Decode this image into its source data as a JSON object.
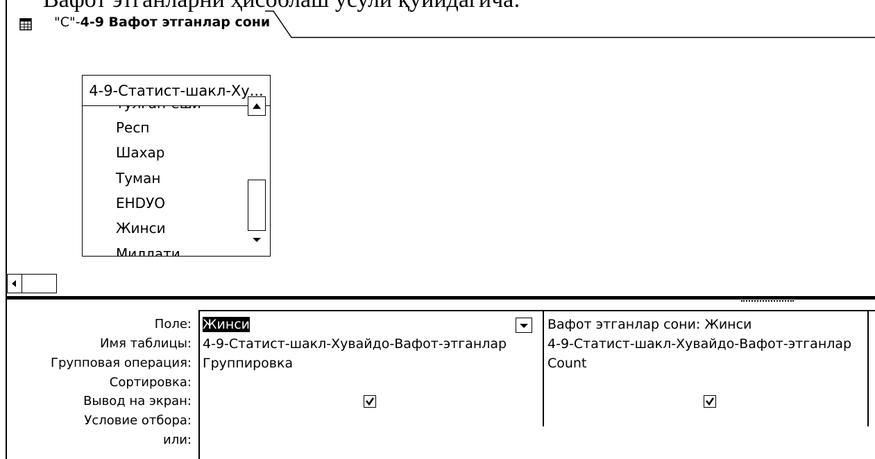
{
  "document": {
    "heading": "Вафот этганларни ҳисоблаш усули қуйидагича:"
  },
  "tab": {
    "prefix": "\"С\"-",
    "title": "4-9   Вафот этганлар сони"
  },
  "table_box": {
    "title": "4-9-Статист-шакл-Ху...",
    "fields": [
      "тулган-еши",
      "Респ",
      "Шахар",
      "Туман",
      "ЕНDУО",
      "Жинси",
      "Миллати"
    ]
  },
  "row_labels": [
    "Поле:",
    "Имя таблицы:",
    "Групповая операция:",
    "Сортировка:",
    "Вывод на экран:",
    "Условие отбора:",
    "или:"
  ],
  "columns": [
    {
      "field": "Жинси",
      "table": "4-9-Статист-шакл-Хувайдо-Вафот-этганлар",
      "group_op": "Группировка",
      "sort": "",
      "show": true,
      "criteria": ""
    },
    {
      "field": "Вафот этганлар сони: Жинси",
      "table": "4-9-Статист-шакл-Хувайдо-Вафот-этганлар",
      "group_op": "Count",
      "sort": "",
      "show": true,
      "criteria": ""
    }
  ]
}
